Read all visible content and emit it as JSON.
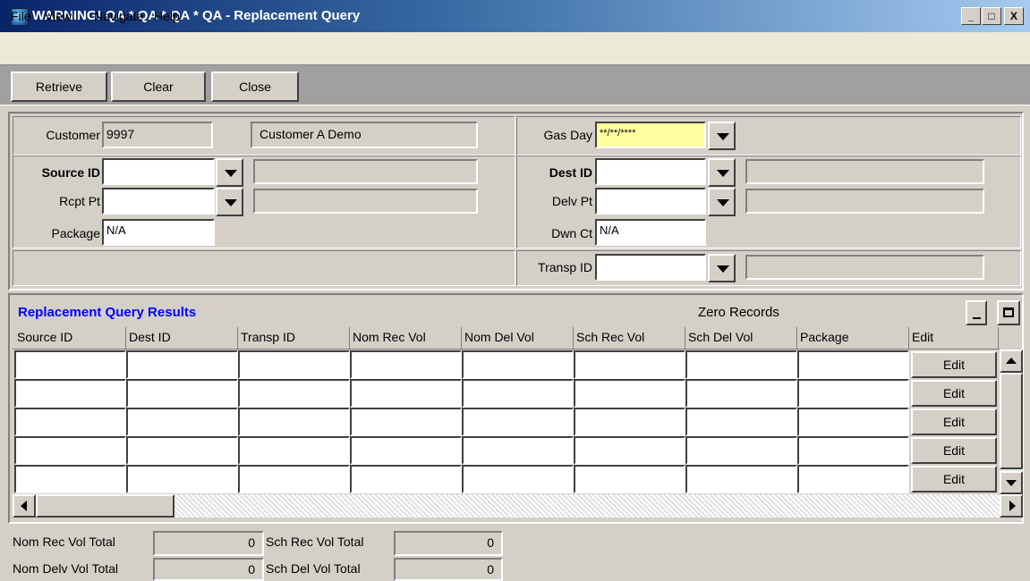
{
  "window": {
    "title": "WARNING!  QA * QA * QA * QA - Replacement Query",
    "minimize_glyph": "_",
    "maximize_glyph": "□",
    "close_glyph": "X",
    "title_icon": "globe-icon"
  },
  "menu": [
    "File",
    "View",
    "Navigate",
    "Help"
  ],
  "toolbar": {
    "retrieve": "Retrieve",
    "clear": "Clear",
    "close": "Close"
  },
  "customer": {
    "label": "Customer",
    "id": "9997",
    "name": "Customer A Demo"
  },
  "gas_day": {
    "label": "Gas Day",
    "value": "**/**/****",
    "highlight": "#ffffa0"
  },
  "source": {
    "source_id_label": "Source ID",
    "source_id_value": "",
    "rcpt_pt_label": "Rcpt Pt",
    "rcpt_pt_value": "",
    "package_label": "Package",
    "package_value": "N/A"
  },
  "dest": {
    "dest_id_label": "Dest ID",
    "dest_id_value": "",
    "delv_pt_label": "Delv Pt",
    "delv_pt_value": "",
    "dwn_ct_label": "Dwn Ct",
    "dwn_ct_value": "N/A",
    "transp_id_label": "Transp ID",
    "transp_id_value": ""
  },
  "results": {
    "title": "Replacement Query Results",
    "title_color": "#0000ff",
    "status": "Zero Records",
    "columns": [
      "Source ID",
      "Dest ID",
      "Transp ID",
      "Nom Rec Vol",
      "Nom Del Vol",
      "Sch Rec Vol",
      "Sch Del Vol",
      "Package",
      "Edit"
    ],
    "edit_label": "Edit",
    "row_count": 5
  },
  "totals": {
    "nom_rec_label": "Nom Rec  Vol Total",
    "nom_rec_value": "0",
    "sch_rec_label": "Sch Rec Vol Total",
    "sch_rec_value": "0",
    "nom_delv_label": "Nom Delv Vol Total",
    "nom_delv_value": "0",
    "sch_del_label": "Sch Del Vol Total",
    "sch_del_value": "0"
  }
}
